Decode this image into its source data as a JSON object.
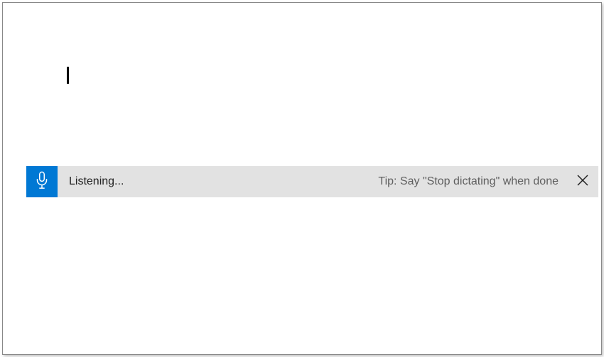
{
  "dictation": {
    "status": "Listening...",
    "tip": "Tip: Say \"Stop dictating\" when done"
  }
}
